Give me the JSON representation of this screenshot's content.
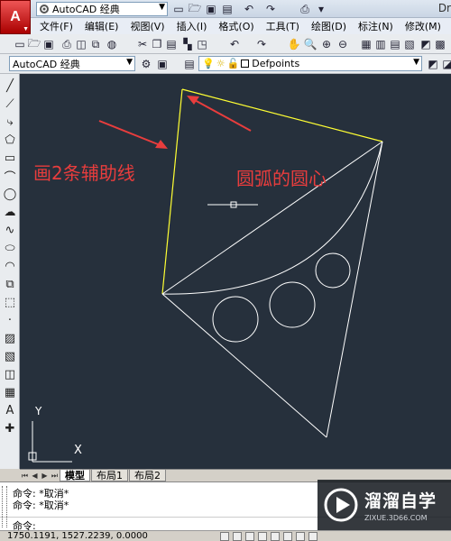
{
  "titlebar": {
    "workspace": "AutoCAD 经典",
    "window_title": "Dr"
  },
  "menu": [
    "文件(F)",
    "编辑(E)",
    "视图(V)",
    "插入(I)",
    "格式(O)",
    "工具(T)",
    "绘图(D)",
    "标注(N)",
    "修改(M)"
  ],
  "toolbar2": {
    "workspace": "AutoCAD 经典",
    "layer": "Defpoints"
  },
  "drawing": {
    "annotations": {
      "left": "画2条辅助线",
      "center": "圆弧的圆心"
    },
    "ucs": {
      "x": "X",
      "y": "Y"
    },
    "colors": {
      "background": "#26303c",
      "aux_lines": "#ffff33",
      "geometry": "#ffffff",
      "annotation": "#e83d3d"
    }
  },
  "tabs": [
    "模型",
    "布局1",
    "布局2"
  ],
  "command": {
    "history": [
      "命令: *取消*",
      "命令: *取消*"
    ],
    "prompt": "命令:"
  },
  "status": {
    "coordinates": "1750.1191, 1527.2239, 0.0000"
  },
  "watermark": {
    "name": "溜溜自学",
    "url": "ZIXUE.3D66.COM"
  }
}
